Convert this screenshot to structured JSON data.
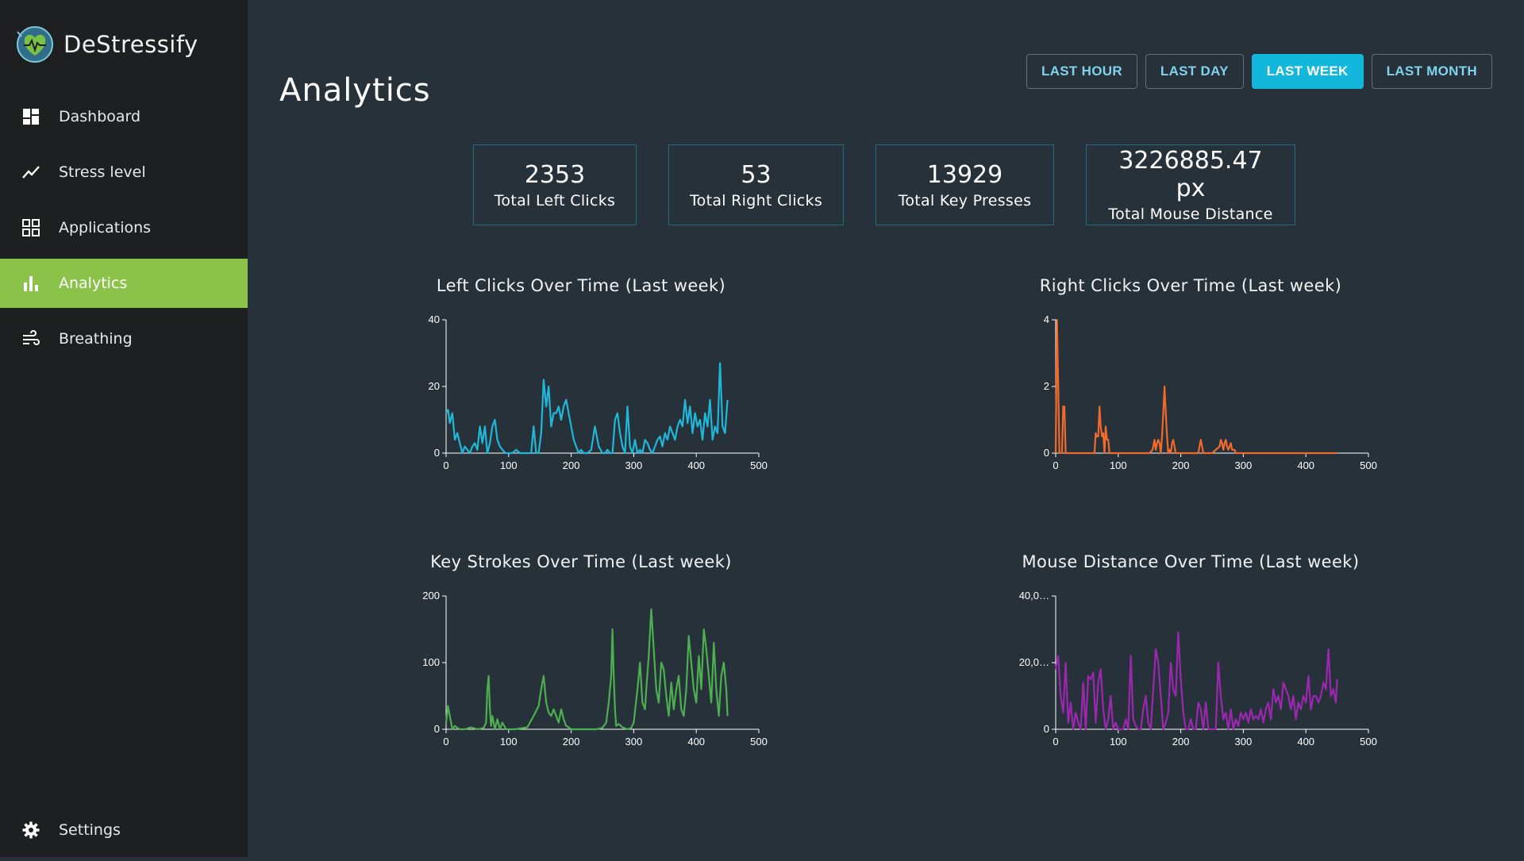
{
  "app": {
    "name": "DeStressify",
    "logo_icon": "heart-pulse-logo-icon"
  },
  "sidebar": {
    "items": [
      {
        "label": "Dashboard",
        "icon": "dashboard-icon",
        "active": false
      },
      {
        "label": "Stress level",
        "icon": "trend-line-icon",
        "active": false
      },
      {
        "label": "Applications",
        "icon": "grid-icon",
        "active": false
      },
      {
        "label": "Analytics",
        "icon": "bar-chart-icon",
        "active": true
      },
      {
        "label": "Breathing",
        "icon": "wind-icon",
        "active": false
      }
    ],
    "settings": {
      "label": "Settings",
      "icon": "gear-icon"
    }
  },
  "header": {
    "title": "Analytics",
    "ranges": [
      {
        "label": "LAST HOUR",
        "active": false
      },
      {
        "label": "LAST DAY",
        "active": false
      },
      {
        "label": "LAST WEEK",
        "active": true
      },
      {
        "label": "LAST MONTH",
        "active": false
      }
    ]
  },
  "stats": [
    {
      "value": "2353",
      "label": "Total Left Clicks"
    },
    {
      "value": "53",
      "label": "Total Right Clicks"
    },
    {
      "value": "13929",
      "label": "Total Key Presses"
    },
    {
      "value": "3226885.47 px",
      "label": "Total Mouse Distance"
    }
  ],
  "colors": {
    "accent": "#8bc34a",
    "active_range": "#12b7db",
    "left_clicks": "#1fb8d8",
    "right_clicks": "#f06a2b",
    "key_strokes": "#4caf50",
    "mouse_distance": "#9c27b0"
  },
  "chart_data": [
    {
      "type": "line",
      "title": "Left Clicks Over Time (Last week)",
      "color": "#1fb8d8",
      "xlim": [
        0,
        500
      ],
      "ylim": [
        0,
        40
      ],
      "xticks": [
        "0",
        "100",
        "200",
        "300",
        "400",
        "500"
      ],
      "yticks": [
        "0",
        "20",
        "40"
      ],
      "x": [
        0,
        3,
        6,
        10,
        14,
        18,
        22,
        26,
        30,
        34,
        38,
        42,
        46,
        50,
        54,
        58,
        62,
        66,
        70,
        74,
        78,
        82,
        86,
        90,
        95,
        100,
        106,
        112,
        118,
        124,
        130,
        136,
        140,
        144,
        148,
        152,
        156,
        160,
        164,
        168,
        172,
        176,
        180,
        184,
        188,
        192,
        196,
        200,
        204,
        208,
        212,
        216,
        220,
        226,
        232,
        238,
        244,
        250,
        254,
        258,
        262,
        266,
        270,
        274,
        278,
        282,
        286,
        290,
        294,
        298,
        302,
        306,
        310,
        314,
        318,
        322,
        326,
        330,
        334,
        338,
        342,
        346,
        350,
        354,
        358,
        362,
        366,
        370,
        374,
        378,
        382,
        386,
        390,
        394,
        398,
        402,
        406,
        410,
        414,
        418,
        422,
        426,
        430,
        434,
        438,
        442,
        446,
        450
      ],
      "y": [
        12,
        13,
        9,
        12,
        4,
        6,
        3,
        0,
        2,
        1,
        0,
        2,
        3,
        1,
        8,
        3,
        8,
        0,
        3,
        8,
        10,
        4,
        2,
        1,
        0,
        0,
        0,
        1,
        0,
        0,
        0,
        0,
        8,
        0,
        0,
        6,
        22,
        14,
        20,
        8,
        12,
        12,
        14,
        10,
        14,
        16,
        12,
        8,
        4,
        2,
        0,
        1,
        0,
        0,
        1,
        8,
        2,
        0,
        0,
        1,
        0,
        0,
        10,
        12,
        6,
        2,
        0,
        14,
        2,
        0,
        4,
        0,
        1,
        0,
        4,
        3,
        1,
        0,
        2,
        4,
        5,
        2,
        6,
        4,
        8,
        6,
        4,
        8,
        10,
        8,
        16,
        9,
        14,
        6,
        12,
        8,
        10,
        4,
        12,
        8,
        16,
        4,
        8,
        6,
        27,
        8,
        6,
        16,
        12
      ],
      "series": [
        {
          "values_from": "y"
        }
      ]
    },
    {
      "type": "line",
      "title": "Right Clicks Over Time (Last week)",
      "color": "#f06a2b",
      "xlim": [
        0,
        500
      ],
      "ylim": [
        0,
        4
      ],
      "xticks": [
        "0",
        "100",
        "200",
        "300",
        "400",
        "500"
      ],
      "yticks": [
        "0",
        "2",
        "4"
      ],
      "x": [
        0,
        2,
        4,
        6,
        8,
        10,
        12,
        14,
        16,
        18,
        20,
        60,
        62,
        64,
        66,
        68,
        70,
        72,
        74,
        76,
        78,
        80,
        82,
        84,
        86,
        150,
        155,
        158,
        160,
        162,
        164,
        166,
        168,
        170,
        172,
        174,
        176,
        178,
        180,
        182,
        184,
        186,
        188,
        190,
        192,
        194,
        196,
        198,
        226,
        228,
        230,
        232,
        234,
        236,
        250,
        262,
        264,
        266,
        268,
        270,
        272,
        274,
        276,
        278,
        280,
        282,
        284,
        286,
        288,
        290,
        300,
        350,
        400,
        450
      ],
      "y": [
        0,
        4,
        2,
        0,
        0,
        0,
        1.4,
        1.4,
        0,
        0,
        0,
        0,
        0,
        0.6,
        0.5,
        0.5,
        1.4,
        0.8,
        0.5,
        0.6,
        0,
        0.8,
        0.4,
        0.4,
        0,
        0,
        0.1,
        0.4,
        0.1,
        0.3,
        0.4,
        0.3,
        0,
        0.5,
        1.2,
        2.0,
        1.2,
        0.5,
        0,
        0.1,
        0,
        0.3,
        0.4,
        0.2,
        0,
        0,
        0,
        0,
        0,
        0,
        0.2,
        0.4,
        0.2,
        0,
        0,
        0.2,
        0.4,
        0.3,
        0.1,
        0.3,
        0.4,
        0.2,
        0.1,
        0.2,
        0.3,
        0.1,
        0.1,
        0.1,
        0,
        0,
        0,
        0,
        0,
        0
      ]
    },
    {
      "type": "line",
      "title": "Key Strokes Over Time (Last week)",
      "color": "#4caf50",
      "xlim": [
        0,
        500
      ],
      "ylim": [
        0,
        200
      ],
      "xticks": [
        "0",
        "100",
        "200",
        "300",
        "400",
        "500"
      ],
      "yticks": [
        "0",
        "100",
        "200"
      ],
      "x": [
        0,
        3,
        6,
        10,
        14,
        18,
        22,
        30,
        40,
        50,
        60,
        64,
        66,
        68,
        70,
        72,
        74,
        78,
        82,
        86,
        90,
        96,
        100,
        110,
        130,
        140,
        148,
        152,
        156,
        160,
        164,
        168,
        172,
        176,
        180,
        184,
        188,
        192,
        196,
        200,
        210,
        230,
        240,
        250,
        256,
        260,
        264,
        266,
        268,
        270,
        272,
        276,
        282,
        290,
        296,
        300,
        306,
        310,
        314,
        318,
        320,
        324,
        328,
        332,
        336,
        340,
        344,
        348,
        352,
        356,
        360,
        364,
        368,
        372,
        376,
        380,
        384,
        388,
        392,
        396,
        400,
        404,
        408,
        412,
        416,
        420,
        424,
        428,
        432,
        436,
        440,
        444,
        448,
        450
      ],
      "y": [
        10,
        35,
        20,
        0,
        5,
        2,
        0,
        0,
        3,
        0,
        2,
        10,
        60,
        80,
        30,
        5,
        20,
        0,
        15,
        0,
        10,
        0,
        0,
        0,
        3,
        20,
        35,
        60,
        80,
        40,
        25,
        20,
        30,
        20,
        10,
        30,
        15,
        5,
        3,
        0,
        0,
        0,
        0,
        2,
        10,
        40,
        80,
        150,
        80,
        30,
        5,
        8,
        3,
        0,
        2,
        10,
        60,
        100,
        40,
        30,
        60,
        110,
        180,
        120,
        60,
        40,
        100,
        90,
        50,
        20,
        70,
        30,
        60,
        80,
        30,
        20,
        60,
        140,
        100,
        60,
        40,
        110,
        60,
        150,
        120,
        80,
        40,
        130,
        60,
        20,
        80,
        100,
        60,
        20
      ]
    },
    {
      "type": "line",
      "title": "Mouse Distance Over Time (Last week)",
      "color": "#9c27b0",
      "xlim": [
        0,
        500
      ],
      "ylim": [
        0,
        40000
      ],
      "xticks": [
        "0",
        "100",
        "200",
        "300",
        "400",
        "500"
      ],
      "yticks": [
        "0",
        "20,0…",
        "40,0…"
      ],
      "x": [
        0,
        4,
        8,
        12,
        16,
        20,
        24,
        28,
        32,
        36,
        40,
        44,
        48,
        52,
        56,
        60,
        64,
        68,
        72,
        76,
        80,
        84,
        88,
        92,
        96,
        100,
        104,
        108,
        112,
        116,
        120,
        124,
        128,
        132,
        136,
        140,
        144,
        148,
        152,
        156,
        160,
        164,
        168,
        172,
        176,
        180,
        184,
        188,
        192,
        196,
        200,
        204,
        208,
        212,
        216,
        220,
        224,
        228,
        232,
        236,
        240,
        244,
        248,
        252,
        256,
        260,
        264,
        268,
        272,
        276,
        280,
        284,
        288,
        292,
        296,
        300,
        304,
        308,
        312,
        316,
        320,
        324,
        328,
        332,
        336,
        340,
        344,
        348,
        352,
        356,
        360,
        364,
        368,
        372,
        376,
        380,
        384,
        388,
        392,
        396,
        400,
        404,
        408,
        412,
        416,
        420,
        424,
        428,
        432,
        436,
        440,
        444,
        448,
        450
      ],
      "y": [
        18000,
        22000,
        10000,
        5000,
        20000,
        2000,
        8000,
        0,
        5000,
        2000,
        0,
        14000,
        0,
        16000,
        15000,
        17000,
        2000,
        14000,
        18000,
        6000,
        0,
        3000,
        10000,
        0,
        2000,
        0,
        0,
        0,
        3000,
        0,
        22000,
        3000,
        1000,
        0,
        0,
        6000,
        10000,
        2000,
        0,
        12000,
        24000,
        20000,
        10000,
        0,
        2000,
        5000,
        20000,
        12000,
        10000,
        29000,
        15000,
        5000,
        0,
        0,
        3000,
        0,
        0,
        8000,
        6000,
        0,
        8000,
        0,
        0,
        0,
        0,
        20000,
        10000,
        3000,
        5000,
        0,
        6000,
        0,
        3000,
        1000,
        5000,
        3000,
        5000,
        2000,
        6000,
        3000,
        4000,
        3000,
        6000,
        2000,
        6000,
        8000,
        3000,
        12000,
        8000,
        10000,
        6000,
        14000,
        12000,
        10000,
        6000,
        10000,
        3000,
        8000,
        6000,
        10000,
        8000,
        16000,
        6000,
        10000,
        10000,
        8000,
        10000,
        14000,
        12000,
        24000,
        10000,
        12000,
        8000,
        15000
      ]
    }
  ]
}
